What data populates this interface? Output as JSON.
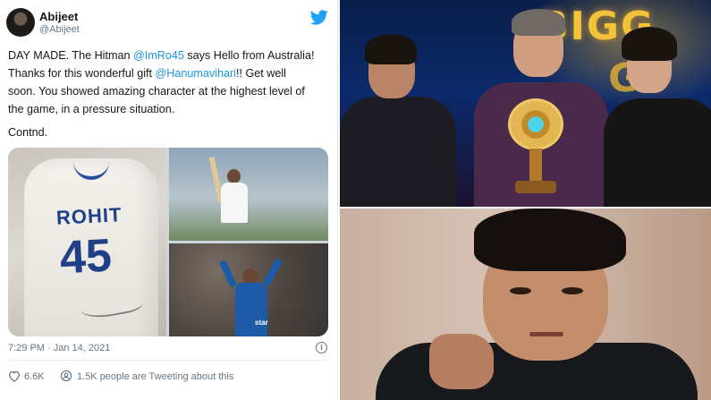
{
  "tweet": {
    "display_name": "Abijeet",
    "handle": "@Abijeet",
    "text": {
      "line1_a": "DAY MADE. The Hitman ",
      "line1_mention": "@ImRo45",
      "line1_b": " says Hello from Australia!",
      "line2_a": "Thanks for this wonderful gift ",
      "line2_mention": "@Hanumavihari",
      "line2_b": "!! Get well",
      "line3": "soon. You showed amazing character at the highest level of",
      "line4": "the game, in a pressure situation."
    },
    "contd": "Contnd.",
    "media": {
      "jersey_name": "ROHIT",
      "jersey_number": "45",
      "sponsor": "star"
    },
    "timestamp": "7:29 PM · Jan 14, 2021",
    "info_glyph": "i",
    "likes": "6.6K",
    "people_text": "1.5K people are Tweeting about this"
  },
  "photos": {
    "top_logo_line1": "BIGG",
    "top_logo_line2": "G"
  },
  "colors": {
    "link": "#1b95e0",
    "twitter_blue": "#1da1f2",
    "meta_gray": "#657786",
    "text": "#14171a"
  },
  "icons": [
    "twitter-bird-icon",
    "info-icon",
    "heart-icon",
    "people-icon"
  ]
}
